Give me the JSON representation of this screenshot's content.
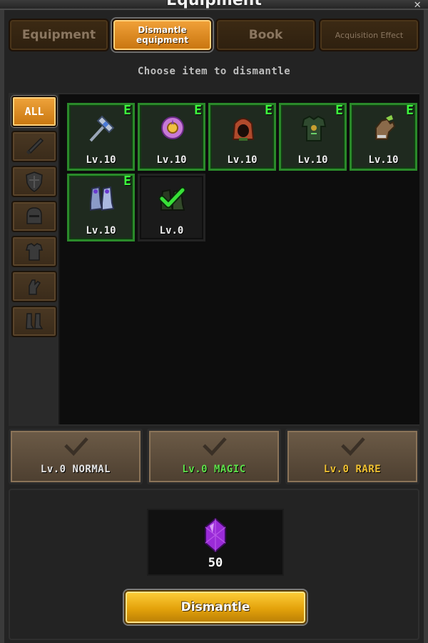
{
  "window": {
    "title": "Equipment"
  },
  "tabs": [
    {
      "label": "Equipment",
      "active": false
    },
    {
      "label": "Dismantle equipment",
      "active": true
    },
    {
      "label": "Book",
      "active": false
    },
    {
      "label": "Acquisition Effect",
      "active": false
    }
  ],
  "subtitle": "Choose item to dismantle",
  "filters": [
    {
      "label": "ALL",
      "icon": "all-label",
      "active": true
    },
    {
      "label": "",
      "icon": "sword-icon"
    },
    {
      "label": "",
      "icon": "shield-icon"
    },
    {
      "label": "",
      "icon": "helmet-icon"
    },
    {
      "label": "",
      "icon": "armor-icon"
    },
    {
      "label": "",
      "icon": "gloves-icon"
    },
    {
      "label": "",
      "icon": "boots-icon"
    }
  ],
  "items": [
    {
      "icon": "hammer-icon",
      "level": "Lv.10",
      "badge": "E",
      "selected": false
    },
    {
      "icon": "orb-icon",
      "level": "Lv.10",
      "badge": "E",
      "selected": false
    },
    {
      "icon": "hood-icon",
      "level": "Lv.10",
      "badge": "E",
      "selected": false
    },
    {
      "icon": "chest-armor-icon",
      "level": "Lv.10",
      "badge": "E",
      "selected": false
    },
    {
      "icon": "gauntlet-icon",
      "level": "Lv.10",
      "badge": "E",
      "selected": false
    },
    {
      "icon": "boots-icon",
      "level": "Lv.10",
      "badge": "E",
      "selected": false
    },
    {
      "icon": "boots-checked-icon",
      "level": "Lv.0",
      "badge": "",
      "selected": true
    }
  ],
  "grades": [
    {
      "label": "Lv.0 NORMAL",
      "color": "#e6e6e6"
    },
    {
      "label": "Lv.0 MAGIC",
      "color": "#5fe04a"
    },
    {
      "label": "Lv.0 RARE",
      "color": "#f1c232"
    }
  ],
  "reward": {
    "icon": "purple-gem-icon",
    "count": "50"
  },
  "action": {
    "dismantle_label": "Dismantle"
  },
  "colors": {
    "accent": "#e89a22",
    "equip_border": "#2a8a2a",
    "badge": "#3dff3d",
    "gem": "#9a2bd8"
  }
}
